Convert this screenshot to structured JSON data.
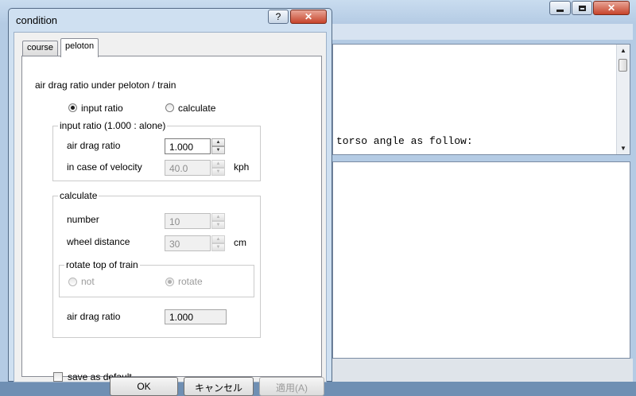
{
  "background_window": {
    "bottom_text": "torso angle as follow:"
  },
  "dialog": {
    "title": "condition",
    "help_button": "?",
    "tabs": [
      {
        "label": "course",
        "selected": false
      },
      {
        "label": "peloton",
        "selected": true
      }
    ],
    "heading": "air drag ratio under peloton / train",
    "mode": {
      "input_ratio_label": "input ratio",
      "calculate_label": "calculate",
      "selected": "input ratio"
    },
    "input_ratio_group": {
      "title": "input ratio (1.000 : alone)",
      "air_drag_ratio_label": "air drag ratio",
      "air_drag_ratio_value": "1.000",
      "velocity_label": "in case of velocity",
      "velocity_value": "40.0",
      "velocity_unit": "kph"
    },
    "calculate_group": {
      "title": "calculate",
      "number_label": "number",
      "number_value": "10",
      "wheel_distance_label": "wheel distance",
      "wheel_distance_value": "30",
      "wheel_distance_unit": "cm",
      "rotate_group": {
        "title": "rotate top of train",
        "not_label": "not",
        "rotate_label": "rotate",
        "selected": "rotate"
      },
      "air_drag_ratio_label": "air drag ratio",
      "air_drag_ratio_value": "1.000"
    },
    "save_default_label": "save as default",
    "save_default_checked": false,
    "buttons": {
      "ok": "OK",
      "cancel": "キャンセル",
      "apply": "適用(A)"
    }
  }
}
